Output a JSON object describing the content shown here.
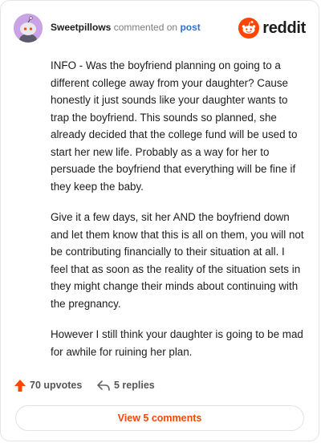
{
  "header": {
    "username": "Sweetpillows",
    "action": "commented on",
    "post_link": "post",
    "brand": "reddit"
  },
  "comment": {
    "paragraphs": [
      "INFO - Was the boyfriend planning on going to a different college away from your daughter? Cause honestly it just sounds like your daughter wants to trap the boyfriend. This sounds so planned, she already decided that the college fund will be used to start her new life. Probably as a way for her to persuade the boyfriend that everything will be fine if they keep the baby.",
      "Give it a few days, sit her AND the boyfriend down and let them know that this is all on them, you will not be contributing financially to their situation at all. I feel that as soon as the reality of the situation sets in they might change their minds about continuing with the pregnancy.",
      "However I still think your daughter is going to be mad for awhile for ruining her plan."
    ]
  },
  "footer": {
    "upvotes": "70 upvotes",
    "replies": "5 replies",
    "view_button": "View 5 comments"
  },
  "icons": {
    "avatar": "snoo-avatar-icon",
    "brand": "reddit-logo-icon",
    "upvote": "upvote-arrow-icon",
    "reply": "reply-arrow-icon"
  },
  "colors": {
    "accent": "#ff4500",
    "link": "#2f6fd6",
    "avatar_bg": "#c9a3e6"
  }
}
